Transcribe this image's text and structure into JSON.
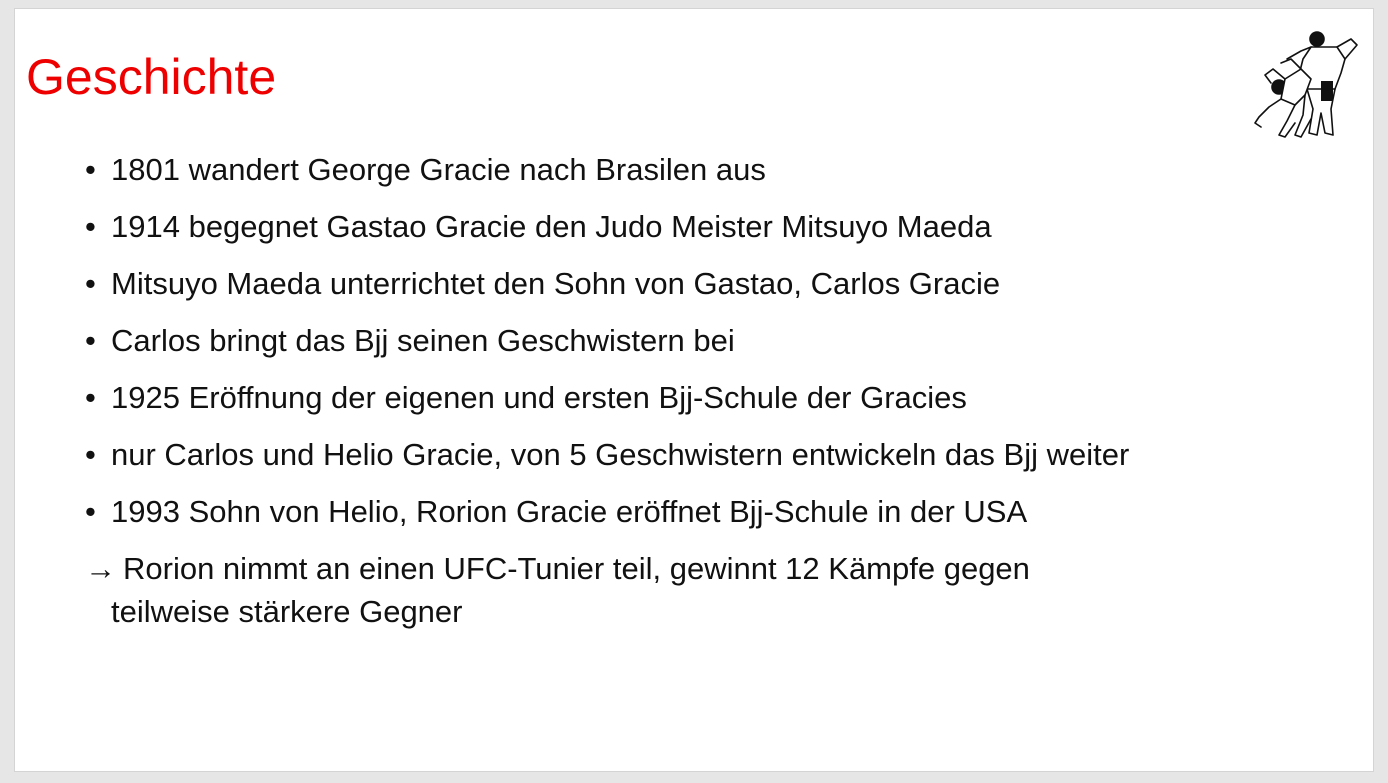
{
  "slide": {
    "title": "Geschichte",
    "bullet_symbol": "•",
    "bullets": [
      "1801 wandert George Gracie nach Brasilen aus",
      "1914 begegnet Gastao Gracie den Judo Meister Mitsuyo Maeda",
      "Mitsuyo Maeda unterrichtet den Sohn von Gastao, Carlos Gracie",
      "Carlos bringt das Bjj seinen Geschwistern bei",
      "1925 Eröffnung der eigenen und ersten Bjj-Schule der Gracies",
      "nur Carlos und Helio Gracie, von 5 Geschwistern entwickeln das Bjj weiter",
      "1993 Sohn von Helio, Rorion Gracie eröffnet Bjj-Schule in der USA"
    ],
    "arrow_symbol": "→",
    "conclusion_line1": "Rorion nimmt an einen UFC-Tunier teil, gewinnt 12 Kämpfe gegen",
    "conclusion_line2": "teilweise stärkere Gegner",
    "title_color": "#ee0000",
    "illustration": "judo-throw-illustration"
  }
}
